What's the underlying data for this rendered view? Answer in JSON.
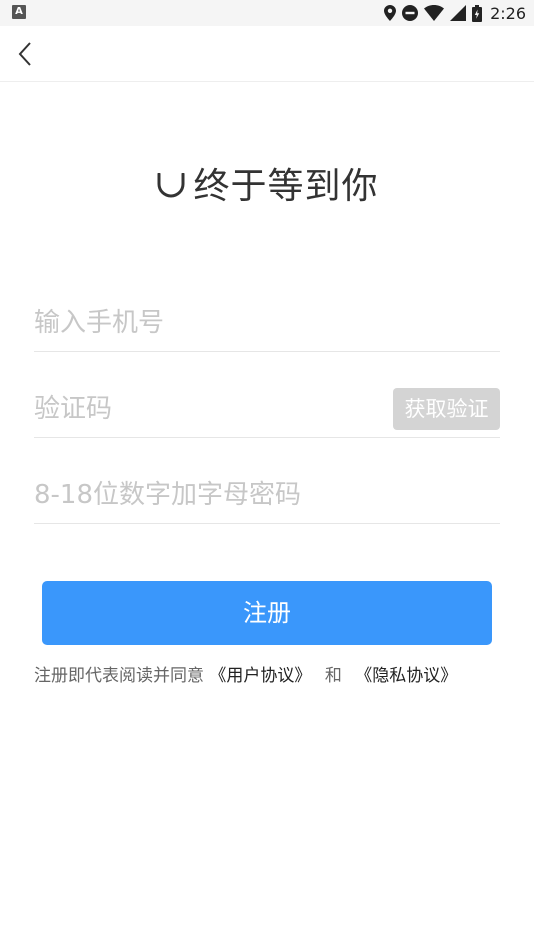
{
  "status_bar": {
    "left_badge": "A",
    "time": "2:26",
    "icons": [
      "location-icon",
      "dnd-icon",
      "wifi-icon",
      "signal-icon",
      "battery-icon"
    ]
  },
  "nav": {
    "back_icon": "chevron-left-icon"
  },
  "title": {
    "icon": "smile-icon",
    "text": "终于等到你"
  },
  "form": {
    "phone": {
      "value": "",
      "placeholder": "输入手机号"
    },
    "code": {
      "value": "",
      "placeholder": "验证码",
      "button_label": "获取验证"
    },
    "password": {
      "value": "",
      "placeholder": "8-18位数字加字母密码"
    }
  },
  "register_label": "注册",
  "agreement": {
    "prefix": "注册即代表阅读并同意",
    "user_link": "《用户协议》",
    "connector": "和",
    "privacy_link": "《隐私协议》"
  },
  "colors": {
    "primary": "#3a97fb",
    "button_disabled": "#d4d4d4",
    "placeholder": "#c7c7c7",
    "divider": "#e6e6e6"
  }
}
